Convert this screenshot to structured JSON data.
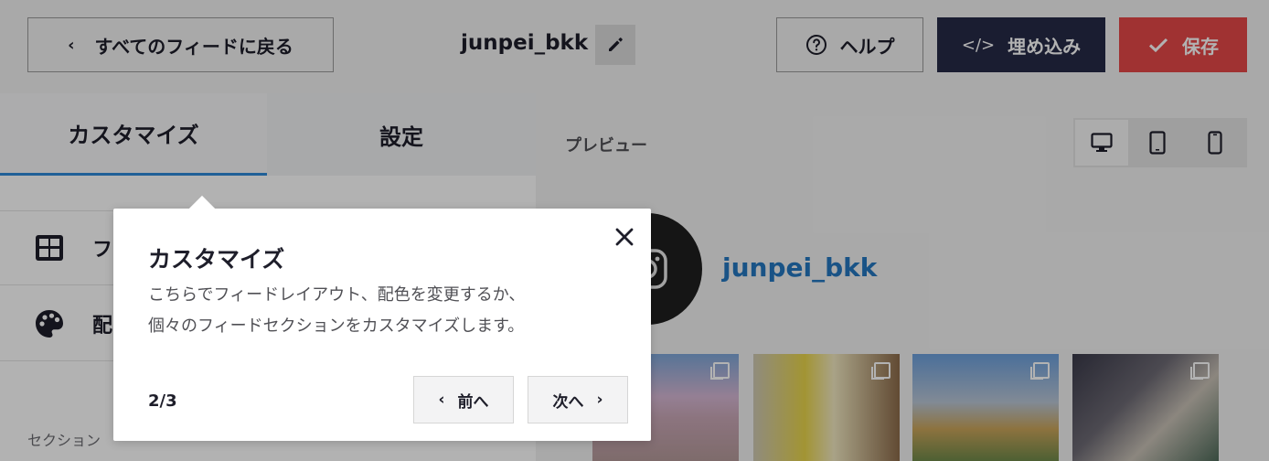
{
  "topbar": {
    "back_label": "すべてのフィードに戻る",
    "feed_title": "junpei_bkk",
    "help_label": "ヘルプ",
    "embed_label": "埋め込み",
    "save_label": "保存"
  },
  "left_panel": {
    "tabs": [
      {
        "label": "カスタマイズ",
        "active": true
      },
      {
        "label": "設定",
        "active": false
      }
    ],
    "menu_items": [
      {
        "label": "フ",
        "icon": "table-layout-icon"
      },
      {
        "label": "配",
        "icon": "palette-icon"
      }
    ],
    "section_label": "セクション"
  },
  "preview": {
    "label": "プレビュー",
    "devices": [
      "desktop-icon",
      "tablet-icon",
      "mobile-icon"
    ],
    "active_device": "desktop",
    "profile_name": "junpei_bkk"
  },
  "tooltip": {
    "title": "カスタマイズ",
    "body_line1": "こちらでフィードレイアウト、配色を変更するか、",
    "body_line2": "個々のフィードセクションをカスタマイズします。",
    "counter": "2/3",
    "prev_label": "前へ",
    "next_label": "次へ"
  },
  "colors": {
    "accent_blue": "#2f8ad8",
    "embed_button": "#262a47",
    "save_button": "#e54848",
    "profile_link": "#2577c0"
  }
}
